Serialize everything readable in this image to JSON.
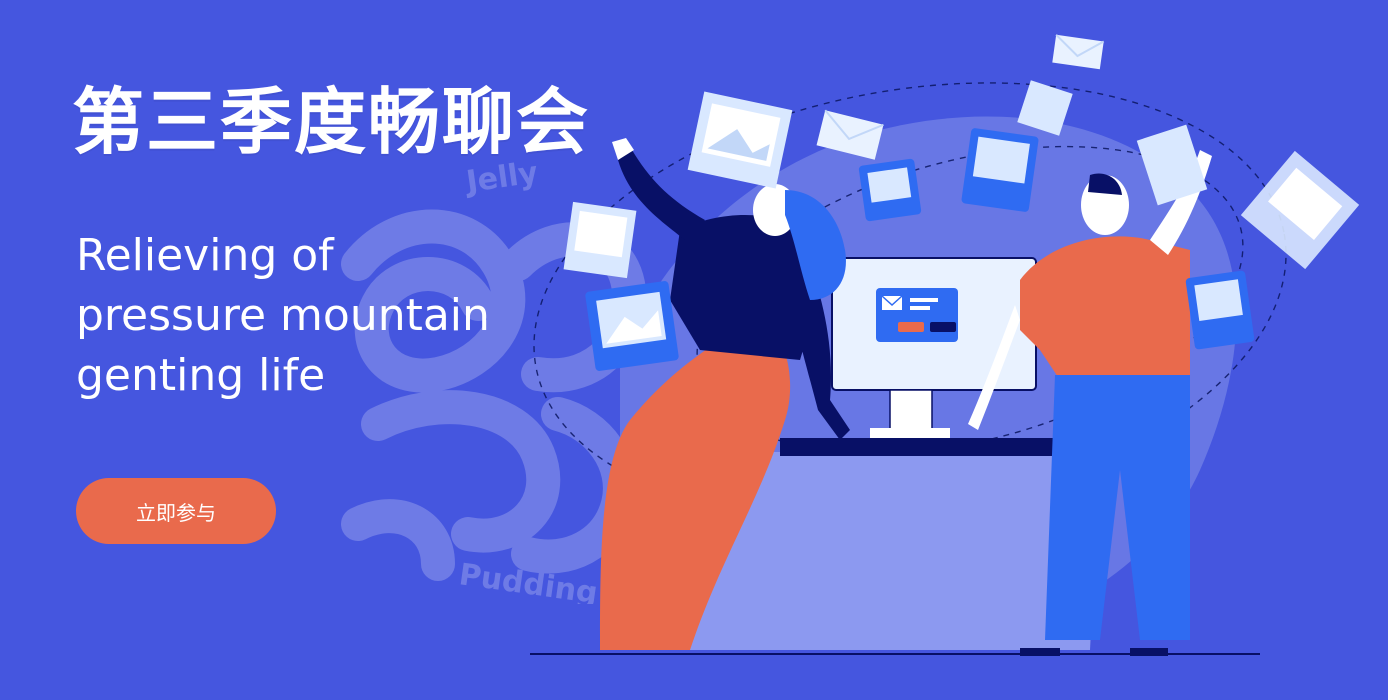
{
  "banner": {
    "title": "第三季度畅聊会",
    "subtitle_lines": [
      "Relieving of",
      "pressure mountain",
      "genting life"
    ],
    "cta_label": "立即参与",
    "watermark": {
      "top_word": "Jelly",
      "bottom_word": "Pudding"
    }
  },
  "colors": {
    "background": "#4556df",
    "accent": "#e96a4c",
    "navy": "#081066",
    "blue": "#2f6bf2",
    "light_card": "#d9e8ff"
  },
  "icons": {
    "photo": "image-icon",
    "mail": "mail-icon",
    "close": "close-icon",
    "check": "check-icon"
  }
}
